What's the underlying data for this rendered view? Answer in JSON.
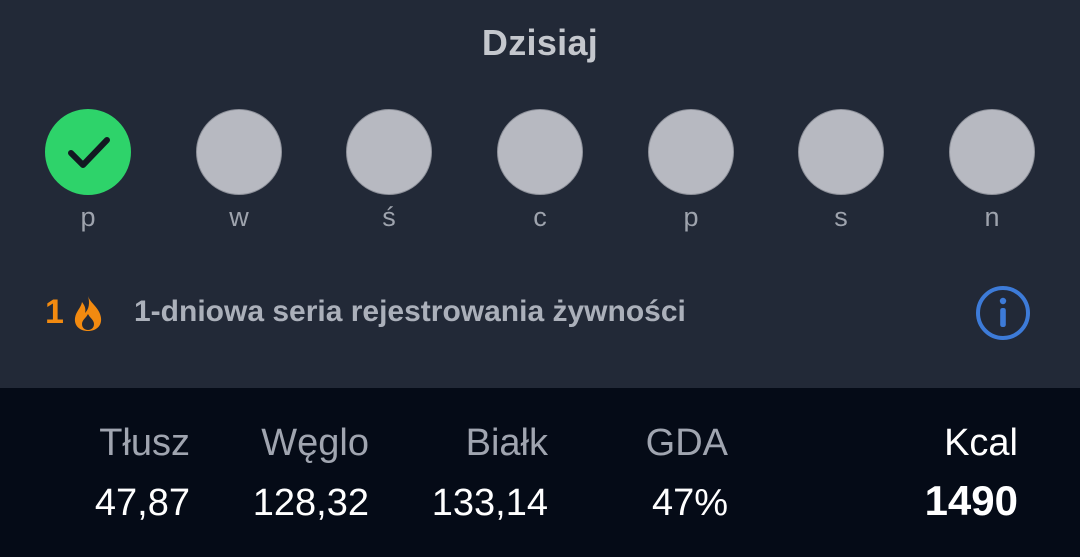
{
  "header": {
    "title": "Dzisiaj"
  },
  "week": {
    "days": [
      {
        "letter": "p",
        "done": true
      },
      {
        "letter": "w",
        "done": false
      },
      {
        "letter": "ś",
        "done": false
      },
      {
        "letter": "c",
        "done": false
      },
      {
        "letter": "p",
        "done": false
      },
      {
        "letter": "s",
        "done": false
      },
      {
        "letter": "n",
        "done": false
      }
    ],
    "done_color": "#2ed36a",
    "pending_color": "#b7b9c1"
  },
  "streak": {
    "count": "1",
    "text": "1-dniowa seria rejestrowania żywności",
    "icon": "flame-icon",
    "info_icon": "info-icon",
    "accent_color": "#f28a10",
    "info_color": "#3d7bd8"
  },
  "summary": {
    "fat": {
      "label": "Tłusz",
      "value": "47,87"
    },
    "carbs": {
      "label": "Węglo",
      "value": "128,32"
    },
    "protein": {
      "label": "Białk",
      "value": "133,14"
    },
    "gda": {
      "label": "GDA",
      "value": "47%"
    },
    "kcal": {
      "label": "Kcal",
      "value": "1490"
    }
  }
}
